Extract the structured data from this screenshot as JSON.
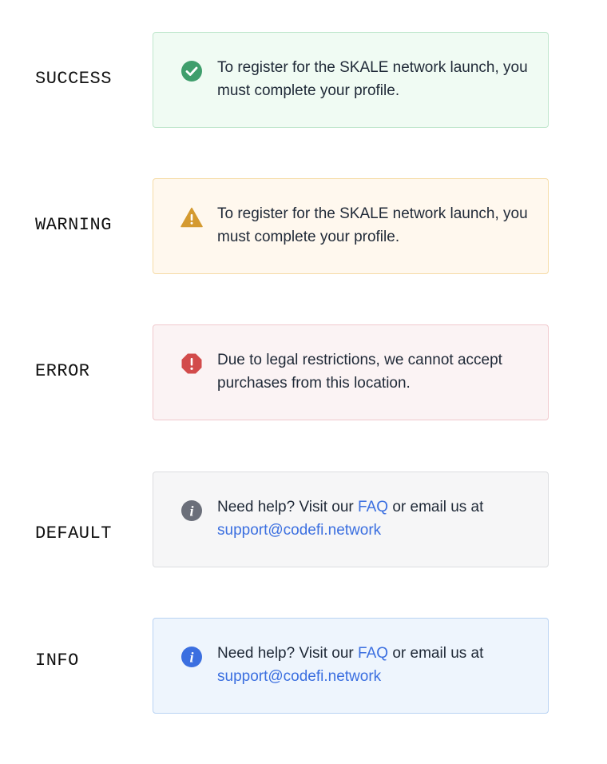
{
  "rows": [
    {
      "label": "SUCCESS",
      "variant": "success",
      "icon": "check-circle-icon",
      "accent": "#3f9e6c",
      "message": "To register for the SKALE network launch, you must complete your profile."
    },
    {
      "label": "WARNING",
      "variant": "warning",
      "icon": "warning-triangle-icon",
      "accent": "#d49a30",
      "message": "To register for the SKALE network launch, you must complete your profile."
    },
    {
      "label": "ERROR",
      "variant": "error",
      "icon": "error-octagon-icon",
      "accent": "#d24b4b",
      "message": "Due to legal restrictions, we cannot accept purchases from this location."
    },
    {
      "label": "DEFAULT",
      "variant": "default",
      "icon": "info-circle-icon",
      "accent": "#6b6f7a",
      "message_prefix": "Need help? Visit our ",
      "faq_link": "FAQ",
      "message_mid": " or email us at",
      "email_link": "support@codefi.network"
    },
    {
      "label": "INFO",
      "variant": "info",
      "icon": "info-circle-icon",
      "accent": "#3b6fe0",
      "message_prefix": "Need help? Visit our ",
      "faq_link": "FAQ",
      "message_mid": " or email us at",
      "email_link": "support@codefi.network"
    }
  ]
}
